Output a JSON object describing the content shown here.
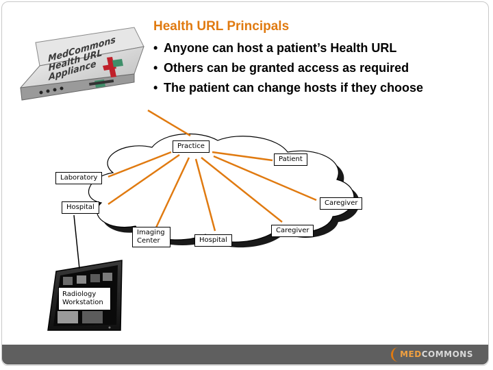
{
  "slide": {
    "title": "Health URL Principals",
    "bullets": [
      "Anyone can host a patient’s Health URL",
      "Others can be granted access as required",
      "The patient can change hosts if they choose"
    ]
  },
  "appliance": {
    "label_lines": [
      "MedCommons",
      "Health URL",
      "Appliance"
    ]
  },
  "nodes": {
    "practice": "Practice",
    "patient": "Patient",
    "laboratory": "Laboratory",
    "hospital_left": "Hospital",
    "caregiver_right": "Caregiver",
    "caregiver_bottom": "Caregiver",
    "imaging_center": [
      "Imaging",
      "Center"
    ],
    "hospital_bottom": "Hospital",
    "radiology_workstation": [
      "Radiology",
      "Workstation"
    ]
  },
  "footer": {
    "logo_part1": "MED",
    "logo_part2": "COMMONS"
  },
  "colors": {
    "accent": "#e07a10",
    "connector": "#e07a10",
    "footer_bar": "#5f5f5f"
  }
}
